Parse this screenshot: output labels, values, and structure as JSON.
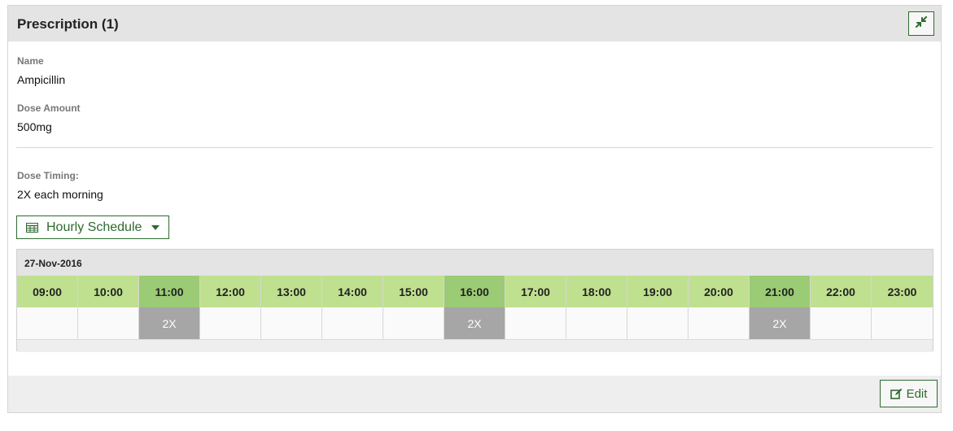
{
  "panel": {
    "title": "Prescription (1)",
    "collapse_icon": "compress-icon"
  },
  "fields": {
    "name_label": "Name",
    "name_value": "Ampicillin",
    "dose_label": "Dose Amount",
    "dose_value": "500mg",
    "timing_label": "Dose Timing:",
    "timing_value": "2X each morning"
  },
  "schedule_button": {
    "label": "Hourly Schedule",
    "icon": "table-icon"
  },
  "schedule": {
    "date": "27-Nov-2016",
    "hours": [
      "09:00",
      "10:00",
      "11:00",
      "12:00",
      "13:00",
      "14:00",
      "15:00",
      "16:00",
      "17:00",
      "18:00",
      "19:00",
      "20:00",
      "21:00",
      "22:00",
      "23:00"
    ],
    "doses": [
      "",
      "",
      "2X",
      "",
      "",
      "",
      "",
      "2X",
      "",
      "",
      "",
      "",
      "2X",
      "",
      ""
    ]
  },
  "footer": {
    "edit_label": "Edit",
    "edit_icon": "edit-icon"
  },
  "colors": {
    "accent": "#2e6b2e",
    "hour_bg": "#bfe08f",
    "hour_active_bg": "#9bcb74",
    "dose_bg": "#a6a6a6"
  }
}
